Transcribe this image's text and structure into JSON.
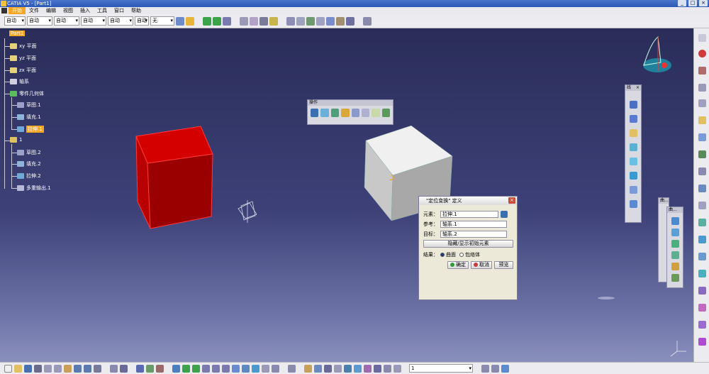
{
  "window": {
    "title": "CATIA V5 - [Part1]",
    "controls": [
      "_",
      "□",
      "×"
    ]
  },
  "menu": {
    "items": [
      "开始",
      "文件",
      "编辑",
      "视图",
      "插入",
      "工具",
      "窗口",
      "帮助"
    ]
  },
  "toolbar": {
    "dropdowns": [
      "自动",
      "自动",
      "自动",
      "自动",
      "自动",
      "自动",
      "无"
    ],
    "colors": {
      "accent": "#f5a623",
      "background": "#2c2f5a"
    }
  },
  "tree": {
    "root": "Part1",
    "nodes": [
      "xy 平面",
      "yz 平面",
      "zx 平面",
      "轴系",
      "零件几何体",
      "草图.1",
      "填充.1",
      "拉伸.1",
      "1",
      "草图.2",
      "填充.2",
      "拉伸.2",
      "多重输出.1"
    ],
    "selected": "拉伸.1"
  },
  "palettes": {
    "operations_title": "操作",
    "wireframe_title": "线",
    "shape_titles": [
      "曲...",
      "曲..."
    ]
  },
  "dialog": {
    "title": "\"定位变换\" 定义",
    "element_label": "元素：",
    "element_value": "拉伸.1",
    "reference_label": "参考：",
    "reference_value": "轴系.1",
    "target_label": "目标：",
    "target_value": "轴系.2",
    "toggle_button": "隐藏/显示初始元素",
    "result_label": "结果：",
    "result_options": [
      "曲面",
      "包络体"
    ],
    "result_selected": "曲面",
    "ok": "确定",
    "cancel": "取消",
    "preview": "预览"
  },
  "statusbar": {
    "input_value": "1"
  }
}
